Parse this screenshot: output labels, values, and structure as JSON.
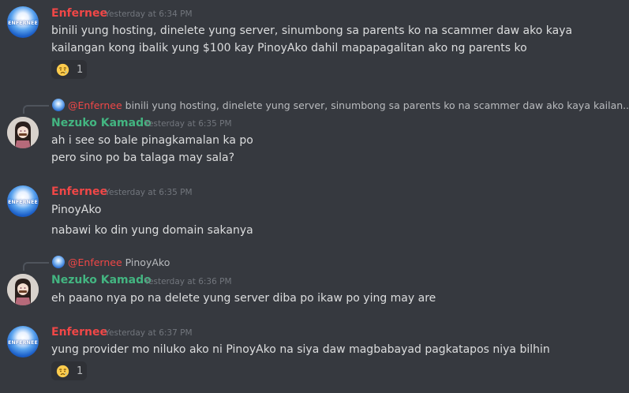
{
  "messages": [
    {
      "author": "Enfernee",
      "timestamp": "Yesterday at 6:34 PM",
      "lines": [
        "binili yung hosting, dinelete yung server, sinumbong sa parents ko na scammer daw ako kaya",
        "kailangan kong ibalik yung $100 kay PinoyAko dahil mapapagalitan ako ng parents ko"
      ],
      "reaction": {
        "emoji": "disappointed-relieved-emoji",
        "count": "1"
      }
    },
    {
      "reply_to": {
        "mention": "@Enfernee",
        "preview": "binili yung hosting, dinelete yung server, sinumbong sa parents ko na scammer daw ako kaya kailan..."
      },
      "author": "Nezuko Kamado",
      "timestamp": "Yesterday at 6:35 PM",
      "lines": [
        "ah i see so bale pinagkamalan ka po",
        "pero sino po ba talaga may sala?"
      ]
    },
    {
      "author": "Enfernee",
      "timestamp": "Yesterday at 6:35 PM",
      "lines": [
        "PinoyAko",
        "nabawi ko din yung domain sakanya"
      ]
    },
    {
      "reply_to": {
        "mention": "@Enfernee",
        "preview": "PinoyAko"
      },
      "author": "Nezuko Kamado",
      "timestamp": "Yesterday at 6:36 PM",
      "lines": [
        "eh paano nya po na delete yung server diba po ikaw po ying may are"
      ]
    },
    {
      "author": "Enfernee",
      "timestamp": "Yesterday at 6:37 PM",
      "lines": [
        "yung provider mo niluko ako ni PinoyAko na siya daw magbabayad pagkatapos niya bilhin"
      ],
      "reaction": {
        "emoji": "disappointed-relieved-emoji",
        "count": "1"
      }
    }
  ],
  "avatars": {
    "enfernee_logo_text": "ENFERNEE"
  },
  "colors": {
    "background": "#36393f",
    "enfernee_name": "#f04747",
    "nezuko_name": "#43b581",
    "timestamp": "#72767d",
    "message_text": "#dcddde"
  }
}
